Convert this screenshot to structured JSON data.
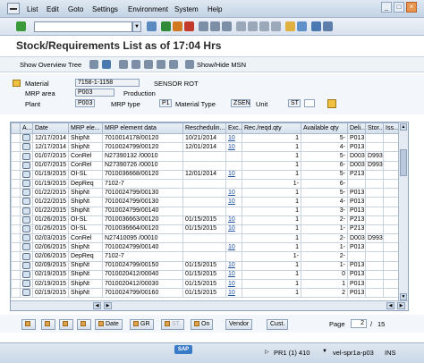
{
  "menubar": {
    "items": [
      "List",
      "Edit",
      "Goto",
      "Settings",
      "Environment",
      "System",
      "Help"
    ]
  },
  "page": {
    "title": "Stock/Requirements List as of 17:04 Hrs"
  },
  "app_toolbar": {
    "show_overview_tree": "Show Overview Tree",
    "show_hide_msn": "Show/Hide MSN"
  },
  "header": {
    "material_label": "Material",
    "material_value": "7158-1-1158",
    "material_desc": "SENSOR ROT",
    "mrp_area_label": "MRP area",
    "mrp_area_value": "P003",
    "mrp_area_desc": "Production",
    "plant_label": "Plant",
    "plant_value": "P003",
    "mrp_type_label": "MRP type",
    "mrp_type_value": "P1",
    "material_type_label": "Material Type",
    "material_type_value": "ZSEN",
    "unit_label": "Unit",
    "unit_value": "ST"
  },
  "grid": {
    "columns": [
      "A...",
      "Date",
      "MRP ele...",
      "MRP element data",
      "Reschedulin...",
      "Exc...",
      "Rec./reqd.qty",
      "Available qty",
      "Deli...",
      "Stor...",
      "Iss..."
    ],
    "rows": [
      [
        "12/17/2014",
        "ShipNt",
        "7010014178/00120",
        "10/21/2014",
        "10",
        "1",
        "5-",
        "P013",
        ""
      ],
      [
        "12/17/2014",
        "ShipNt",
        "7010024799/00120",
        "12/01/2014",
        "10",
        "1",
        "4-",
        "P013",
        ""
      ],
      [
        "01/07/2015",
        "ConRel",
        "N27390132 /00010",
        "",
        "",
        "1",
        "5-",
        "D003",
        "D993"
      ],
      [
        "01/07/2015",
        "ConRel",
        "N27390726 /00010",
        "",
        "",
        "1",
        "6-",
        "D003",
        "D993"
      ],
      [
        "01/19/2015",
        "OI-SL",
        "7010036668/00120",
        "12/01/2014",
        "10",
        "1",
        "5-",
        "P213",
        ""
      ],
      [
        "01/19/2015",
        "DepReq",
        "7102-7",
        "",
        "",
        "1-",
        "6-",
        "",
        ""
      ],
      [
        "01/22/2015",
        "ShipNt",
        "7010024799/00130",
        "",
        "10",
        "1",
        "5-",
        "P013",
        ""
      ],
      [
        "01/22/2015",
        "ShipNt",
        "7010024799/00130",
        "",
        "10",
        "1",
        "4-",
        "P013",
        ""
      ],
      [
        "01/22/2015",
        "ShipNt",
        "7010024799/00140",
        "",
        "",
        "1",
        "3-",
        "P013",
        ""
      ],
      [
        "01/26/2015",
        "OI-SL",
        "7010036663/00120",
        "01/15/2015",
        "10",
        "1",
        "2-",
        "P213",
        ""
      ],
      [
        "01/26/2015",
        "OI-SL",
        "7010036664/00120",
        "01/15/2015",
        "10",
        "1",
        "1-",
        "P213",
        ""
      ],
      [
        "02/03/2015",
        "ConRel",
        "N27410095 /00010",
        "",
        "",
        "1",
        "2-",
        "D003",
        "D993"
      ],
      [
        "02/06/2015",
        "ShipNt",
        "7010024799/00140",
        "",
        "10",
        "1",
        "1-",
        "P013",
        ""
      ],
      [
        "02/06/2015",
        "DepReq",
        "7102-7",
        "",
        "",
        "1-",
        "2-",
        "",
        ""
      ],
      [
        "02/09/2015",
        "ShipNt",
        "7010024799/00150",
        "01/15/2015",
        "10",
        "1",
        "1-",
        "P013",
        ""
      ],
      [
        "02/19/2015",
        "ShipNt",
        "7010020412/00040",
        "01/15/2015",
        "10",
        "1",
        "0",
        "P013",
        ""
      ],
      [
        "02/19/2015",
        "ShipNt",
        "7010020412/00030",
        "01/15/2015",
        "10",
        "1",
        "1",
        "P013",
        ""
      ],
      [
        "02/19/2015",
        "ShipNt",
        "7010024799/00160",
        "01/15/2015",
        "10",
        "1",
        "2",
        "P013",
        ""
      ]
    ]
  },
  "buttons": {
    "date": "Date",
    "gr": "GR",
    "st": "ST.",
    "on": "On",
    "vendor": "Vendor",
    "cust": "Cust."
  },
  "paging": {
    "page_label": "Page",
    "current": "2",
    "total": "15"
  },
  "status": {
    "sap_logo": "SAP",
    "system": "PR1 (1) 410",
    "server": "vel-spr1a-p03",
    "mode": "INS"
  }
}
